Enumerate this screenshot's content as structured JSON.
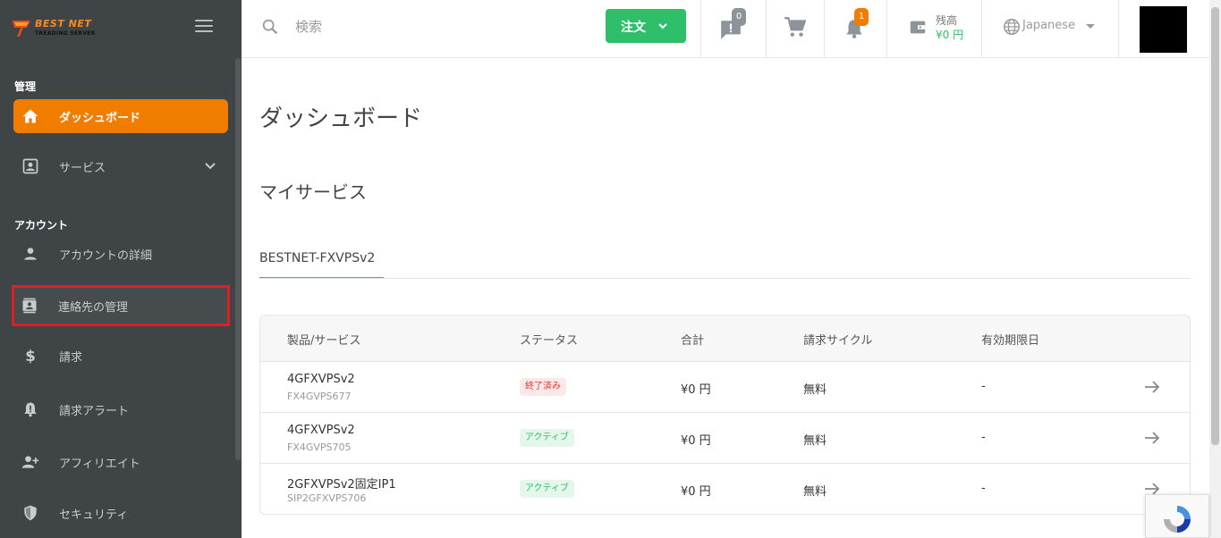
{
  "logo": {
    "line1": "BEST NET",
    "line2": "TREADING SERVER"
  },
  "sidebar": {
    "section_admin": "管理",
    "section_account": "アカウント",
    "items": [
      {
        "label": "ダッシュボード",
        "icon": "home-icon"
      },
      {
        "label": "サービス",
        "icon": "services-icon"
      },
      {
        "label": "アカウントの詳細",
        "icon": "user-icon"
      },
      {
        "label": "連絡先の管理",
        "icon": "contacts-icon"
      },
      {
        "label": "請求",
        "icon": "dollar-icon"
      },
      {
        "label": "請求アラート",
        "icon": "alert-bell-icon"
      },
      {
        "label": "アフィリエイト",
        "icon": "affiliate-icon"
      },
      {
        "label": "セキュリティ",
        "icon": "shield-icon"
      }
    ]
  },
  "header": {
    "search_placeholder": "検索",
    "order_label": "注文",
    "tickets_count": "0",
    "notifications_count": "1",
    "balance_label": "残高",
    "balance_value": "¥0 円",
    "language": "Japanese"
  },
  "main": {
    "title": "ダッシュボード",
    "section_title": "マイサービス",
    "tab_label": "BESTNET-FXVPSv2",
    "table": {
      "columns": [
        "製品/サービス",
        "ステータス",
        "合計",
        "請求サイクル",
        "有効期限日"
      ],
      "rows": [
        {
          "name": "4GFXVPSv2",
          "sub": "FX4GVPS677",
          "status": "終了済み",
          "total": "¥0 円",
          "cycle": "無料",
          "expiry": "-"
        },
        {
          "name": "4GFXVPSv2",
          "sub": "FX4GVPS705",
          "status": "アクティブ",
          "total": "¥0 円",
          "cycle": "無料",
          "expiry": "-"
        },
        {
          "name": "2GFXVPSv2固定IP1",
          "sub": "SIP2GFXVPS706",
          "status": "アクティブ",
          "total": "¥0 円",
          "cycle": "無料",
          "expiry": "-"
        }
      ]
    }
  },
  "colors": {
    "accent": "#f07d00",
    "success": "#2fbf6a",
    "sidebar_bg": "#3f4447",
    "highlight_border": "#e02020"
  }
}
